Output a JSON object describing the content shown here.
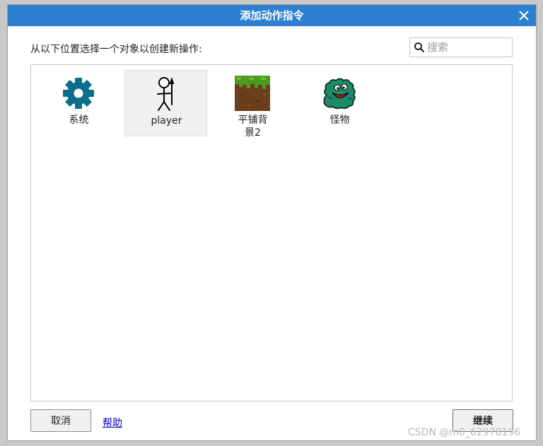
{
  "dialog": {
    "title": "添加动作指令",
    "prompt": "从以下位置选择一个对象以创建新操作:",
    "search": {
      "placeholder": "搜索",
      "value": ""
    },
    "objects": [
      {
        "label": "系统",
        "icon": "gear-icon",
        "selected": false
      },
      {
        "label": "player",
        "icon": "stick-figure-icon",
        "selected": true
      },
      {
        "label": "平铺背景2",
        "icon": "grass-dirt-tile-icon",
        "selected": false
      },
      {
        "label": "怪物",
        "icon": "green-monster-icon",
        "selected": false
      }
    ],
    "buttons": {
      "cancel": "取消",
      "help": "帮助",
      "continue": "继续"
    }
  },
  "watermark": "CSDN @m0_62978196",
  "colors": {
    "titlebar": "#2d7fcf",
    "gear": "#0b6e8a",
    "monster": "#1f8a6a",
    "dirt": "#6b3f1b",
    "grass": "#4c9a1f",
    "link": "#0b00cc"
  }
}
